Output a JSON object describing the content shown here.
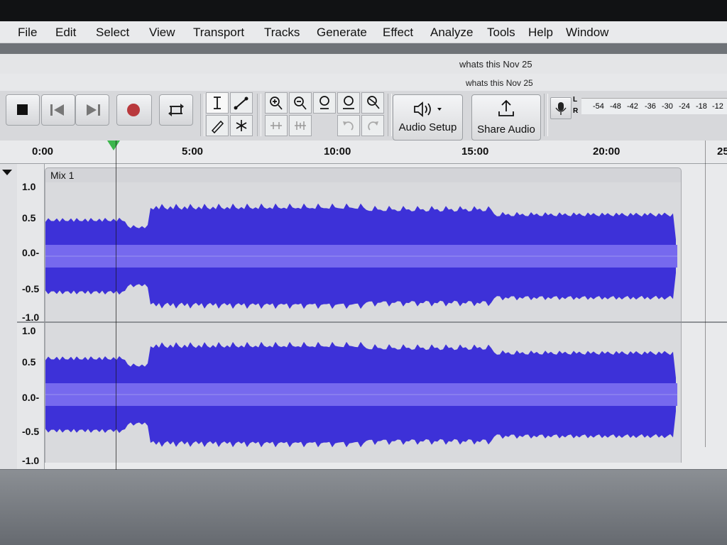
{
  "menu": [
    "File",
    "Edit",
    "Select",
    "View",
    "Transport",
    "Tracks",
    "Generate",
    "Effect",
    "Analyze",
    "Tools",
    "Help",
    "Window"
  ],
  "window": {
    "title": "whats this Nov 25",
    "subtitle": "whats this Nov 25"
  },
  "toolbar": {
    "audio_setup": "Audio Setup",
    "share_audio": "Share Audio",
    "meter_L": "L",
    "meter_R": "R",
    "meter_ticks": [
      "-54",
      "-48",
      "-42",
      "-36",
      "-30",
      "-24",
      "-18",
      "-12"
    ]
  },
  "ruler": {
    "ticks": [
      "0:00",
      "5:00",
      "10:00",
      "15:00",
      "20:00",
      "25"
    ]
  },
  "track": {
    "name": "Mix 1",
    "scale_top": [
      "1.0",
      "0.5",
      "0.0-",
      "-0.5",
      "-1.0"
    ],
    "scale_bottom": [
      "1.0",
      "0.5",
      "0.0-",
      "-0.5",
      "-1.0"
    ]
  },
  "colors": {
    "waveform": "#3d31d8",
    "waveform_rms": "#7669ee",
    "accent_green": "#39b54a"
  }
}
